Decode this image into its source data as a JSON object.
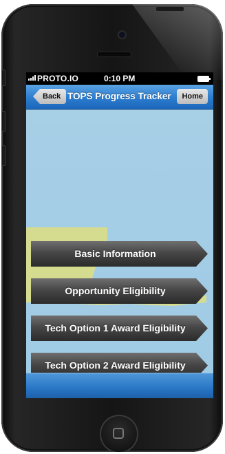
{
  "status_bar": {
    "carrier": "PROTO.IO",
    "time": "0:10 PM"
  },
  "nav": {
    "back_label": "Back",
    "title": "TOPS Progress Tracker",
    "home_label": "Home"
  },
  "menu": [
    {
      "label": "Basic Information"
    },
    {
      "label": "Opportunity Eligibility"
    },
    {
      "label": "Tech Option 1 Award Eligibility"
    },
    {
      "label": "Tech Option 2 Award Eligibility"
    }
  ],
  "colors": {
    "nav_bar": "#2f7fd0",
    "content_background": "#a7cfe6",
    "map_land": "#d6dc8f",
    "menu_button": "#474747"
  }
}
